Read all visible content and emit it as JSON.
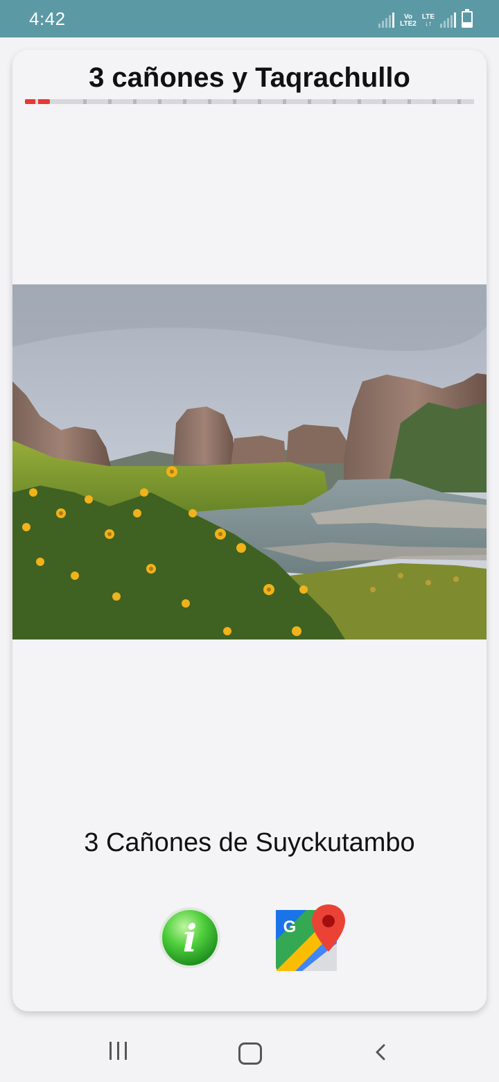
{
  "status_bar": {
    "time": "4:42",
    "volte_label": "Vo\nLTE2",
    "lte_label": "LTE"
  },
  "app": {
    "title": "3 cañones y Taqrachullo",
    "progress": {
      "total_segments": 18,
      "current_index": 1
    },
    "caption": "3 Cañones de Suyckutambo",
    "info_icon_letter": "i",
    "maps_icon_letter": "G"
  },
  "colors": {
    "status_bar": "#5b99a5",
    "progress_active": "#e53935",
    "info_green": "#2fb52f",
    "maps_pin": "#e53935"
  },
  "nav": {
    "recents": "recents-icon",
    "home": "home-icon",
    "back": "back-icon"
  }
}
